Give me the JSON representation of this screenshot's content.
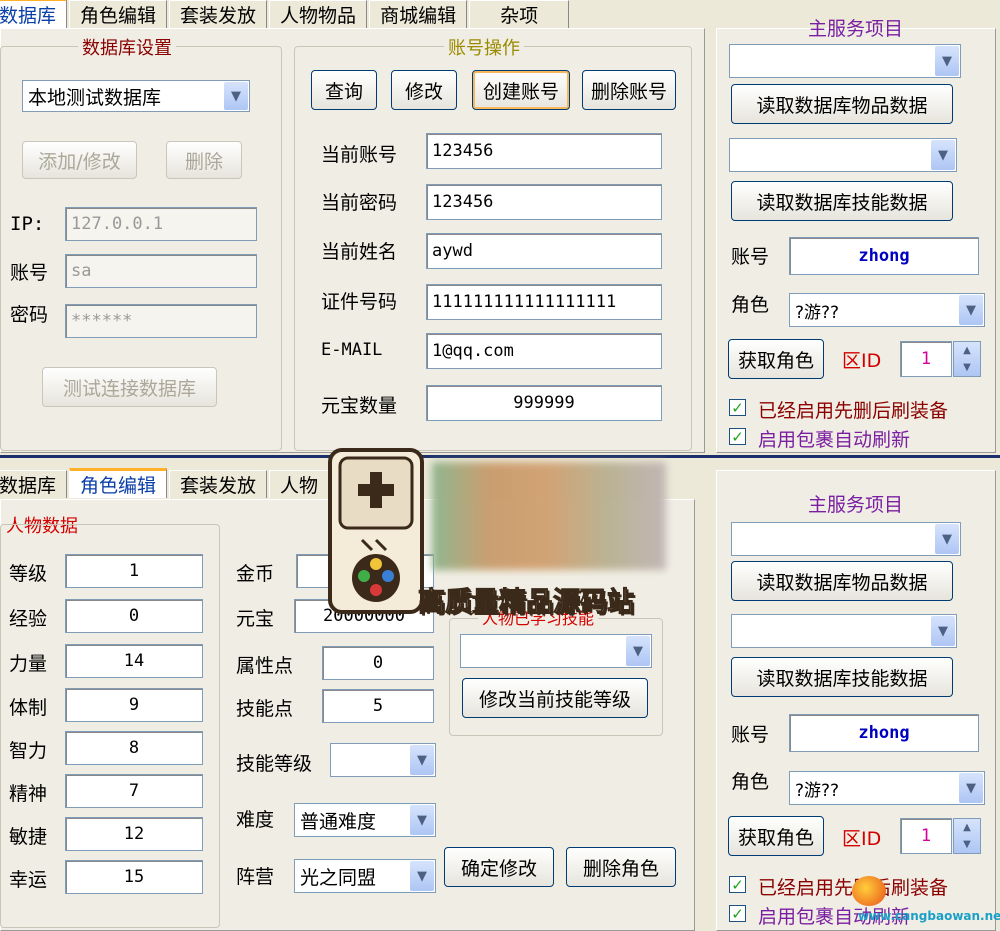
{
  "top": {
    "tabs": [
      "数据库",
      "角色编辑",
      "套装发放",
      "人物物品",
      "商城编辑",
      "杂项"
    ],
    "db": {
      "title": "数据库设置",
      "selected": "本地测试数据库",
      "add_btn": "添加/修改",
      "del_btn": "删除",
      "ip_label": "IP:",
      "ip_value": "127.0.0.1",
      "user_label": "账号",
      "user_value": "sa",
      "pass_label": "密码",
      "pass_value": "******",
      "test_btn": "测试连接数据库"
    },
    "account": {
      "title": "账号操作",
      "buttons": [
        "查询",
        "修改",
        "创建账号",
        "删除账号"
      ],
      "fields": [
        {
          "label": "当前账号",
          "value": "123456"
        },
        {
          "label": "当前密码",
          "value": "123456"
        },
        {
          "label": "当前姓名",
          "value": "aywd"
        },
        {
          "label": "证件号码",
          "value": "111111111111111111"
        },
        {
          "label": "E-MAIL",
          "value": "1@qq.com"
        },
        {
          "label": "元宝数量",
          "value": "999999"
        }
      ]
    },
    "service": {
      "title": "主服务项目",
      "read_items": "读取数据库物品数据",
      "read_skills": "读取数据库技能数据",
      "account_label": "账号",
      "account_value": "zhong",
      "role_label": "角色",
      "role_value": "?游??",
      "get_role": "获取角色",
      "zone_label": "区ID",
      "zone_value": "1",
      "chk1": "已经启用先删后刷装备",
      "chk2": "启用包裹自动刷新"
    }
  },
  "bottom": {
    "tabs": [
      "数据库",
      "角色编辑",
      "套装发放",
      "人物"
    ],
    "char_title": "人物数据",
    "stats": [
      {
        "label": "等级",
        "value": "1"
      },
      {
        "label": "经验",
        "value": "0"
      },
      {
        "label": "力量",
        "value": "14"
      },
      {
        "label": "体制",
        "value": "9"
      },
      {
        "label": "智力",
        "value": "8"
      },
      {
        "label": "精神",
        "value": "7"
      },
      {
        "label": "敏捷",
        "value": "12"
      },
      {
        "label": "幸运",
        "value": "15"
      }
    ],
    "gold_label": "金币",
    "yuanbao_label": "元宝",
    "yuanbao_value": "20000000",
    "attr_label": "属性点",
    "attr_value": "0",
    "skillpt_label": "技能点",
    "skillpt_value": "5",
    "skilllv_label": "技能等级",
    "difficulty_label": "难度",
    "difficulty_value": "普通难度",
    "faction_label": "阵营",
    "faction_value": "光之同盟",
    "confirm_btn": "确定修改",
    "delete_btn": "删除角色",
    "learned_title": "人物已学习技能",
    "modify_skill_btn": "修改当前技能等级",
    "service": {
      "title": "主服务项目",
      "read_items": "读取数据库物品数据",
      "read_skills": "读取数据库技能数据",
      "account_label": "账号",
      "account_value": "zhong",
      "role_label": "角色",
      "role_value": "?游??",
      "get_role": "获取角色",
      "zone_label": "区ID",
      "zone_value": "1",
      "chk1": "已经启用先删后刷装备",
      "chk2": "启用包裹自动刷新"
    }
  },
  "watermark": {
    "text": "高质量精品源码站",
    "corner_text": "www.cangbaowan.net"
  }
}
